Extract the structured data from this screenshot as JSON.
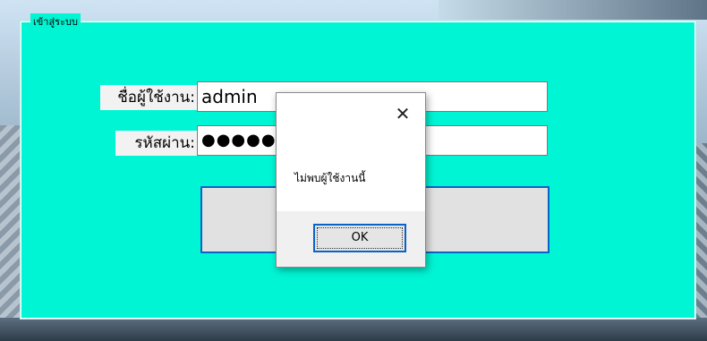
{
  "login_group": {
    "title": "เข้าสู่ระบบ",
    "username_label": "ชื่อผู้ใช้งาน:",
    "username_value": "admin",
    "password_label": "รหัสผ่าน:",
    "password_value": "●●●●●●●",
    "login_button_label": ""
  },
  "message_box": {
    "message": "ไม่พบผู้ใช้งานนี้",
    "ok_label": "OK",
    "close_glyph": "✕"
  },
  "colors": {
    "form_background": "#00f5d4",
    "focus_border": "#0a64c8"
  }
}
